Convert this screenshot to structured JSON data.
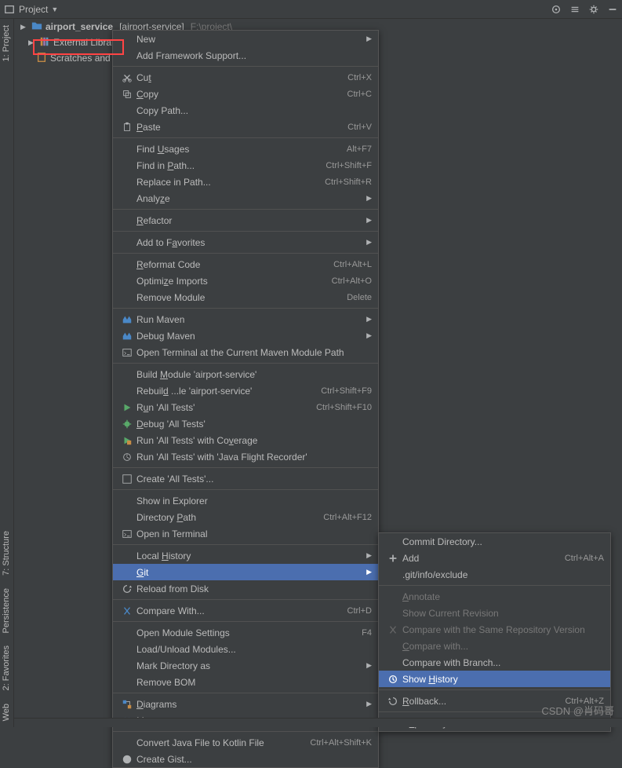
{
  "toolbar": {
    "project_label": "Project",
    "dropdown": "▼"
  },
  "sidebar": {
    "tabs": [
      "1: Project",
      "7: Structure",
      "Persistence",
      "2: Favorites",
      "Web"
    ]
  },
  "tree": {
    "root_label": "airport_service",
    "root_bracket": "[airport-service]",
    "root_path": "F:\\project\\",
    "external_libs": "External Libraries",
    "scratches": "Scratches and Consoles"
  },
  "menu": {
    "new": "New",
    "add_framework": "Add Framework Support...",
    "cut": "Cut",
    "cut_sc": "Ctrl+X",
    "copy": "Copy",
    "copy_sc": "Ctrl+C",
    "copy_path": "Copy Path...",
    "paste": "Paste",
    "paste_sc": "Ctrl+V",
    "find_usages": "Find Usages",
    "find_usages_sc": "Alt+F7",
    "find_in_path": "Find in Path...",
    "find_in_path_sc": "Ctrl+Shift+F",
    "replace_in_path": "Replace in Path...",
    "replace_in_path_sc": "Ctrl+Shift+R",
    "analyze": "Analyze",
    "refactor": "Refactor",
    "add_favorites": "Add to Favorites",
    "reformat": "Reformat Code",
    "reformat_sc": "Ctrl+Alt+L",
    "optimize": "Optimize Imports",
    "optimize_sc": "Ctrl+Alt+O",
    "remove_module": "Remove Module",
    "remove_module_sc": "Delete",
    "run_maven": "Run Maven",
    "debug_maven": "Debug Maven",
    "open_terminal_maven": "Open Terminal at the Current Maven Module Path",
    "build_module": "Build Module 'airport-service'",
    "rebuild": "Rebuild ...le 'airport-service'",
    "rebuild_sc": "Ctrl+Shift+F9",
    "run_all": "Run 'All Tests'",
    "run_all_sc": "Ctrl+Shift+F10",
    "debug_all": "Debug 'All Tests'",
    "run_coverage": "Run 'All Tests' with Coverage",
    "run_flight": "Run 'All Tests' with 'Java Flight Recorder'",
    "create_all": "Create 'All Tests'...",
    "show_explorer": "Show in Explorer",
    "directory_path": "Directory Path",
    "directory_path_sc": "Ctrl+Alt+F12",
    "open_in_terminal": "Open in Terminal",
    "local_history": "Local History",
    "git": "Git",
    "reload_disk": "Reload from Disk",
    "compare_with": "Compare With...",
    "compare_with_sc": "Ctrl+D",
    "open_module_settings": "Open Module Settings",
    "open_module_settings_sc": "F4",
    "load_unload": "Load/Unload Modules...",
    "mark_directory": "Mark Directory as",
    "remove_bom": "Remove BOM",
    "diagrams": "Diagrams",
    "maven": "Maven",
    "convert_kotlin": "Convert Java File to Kotlin File",
    "convert_kotlin_sc": "Ctrl+Alt+Shift+K",
    "create_gist": "Create Gist..."
  },
  "submenu": {
    "commit_dir": "Commit Directory...",
    "add": "Add",
    "add_sc": "Ctrl+Alt+A",
    "git_exclude": ".git/info/exclude",
    "annotate": "Annotate",
    "show_current": "Show Current Revision",
    "compare_same": "Compare with the Same Repository Version",
    "compare_with2": "Compare with...",
    "compare_branch": "Compare with Branch...",
    "show_history": "Show History",
    "rollback": "Rollback...",
    "rollback_sc": "Ctrl+Alt+Z",
    "repository": "Repository"
  },
  "watermark": "CSDN @肖码哥"
}
